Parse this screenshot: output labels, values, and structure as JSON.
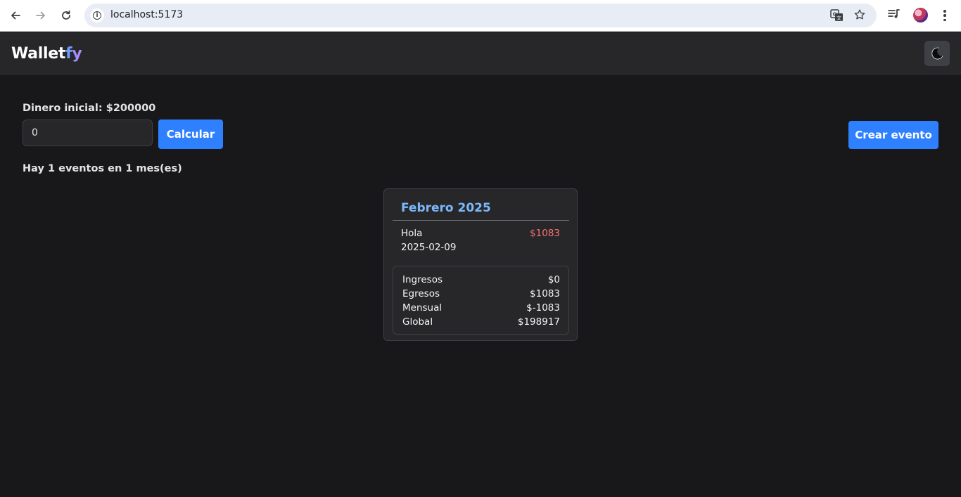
{
  "browser": {
    "url": "localhost:5173"
  },
  "header": {
    "brand_main": "Wallet",
    "brand_accent": "fy",
    "theme_icon": "moon-icon"
  },
  "main": {
    "initial_money_label": "Dinero inicial: $200000",
    "amount_value": "0",
    "calculate_label": "Calcular",
    "create_event_label": "Crear evento",
    "summary": "Hay 1 eventos en 1 mes(es)"
  },
  "months": [
    {
      "title": "Febrero 2025",
      "events": [
        {
          "name": "Hola",
          "amount": "$1083",
          "date": "2025-02-09"
        }
      ],
      "totals": [
        {
          "label": "Ingresos",
          "value": "$0"
        },
        {
          "label": "Egresos",
          "value": "$1083"
        },
        {
          "label": "Mensual",
          "value": "$-1083"
        },
        {
          "label": "Global",
          "value": "$198917"
        }
      ]
    }
  ],
  "colors": {
    "background": "#18181b",
    "header": "#27272a",
    "primary_button": "#2f80ff",
    "month_title": "#7cb8fb",
    "expense": "#f87171"
  }
}
